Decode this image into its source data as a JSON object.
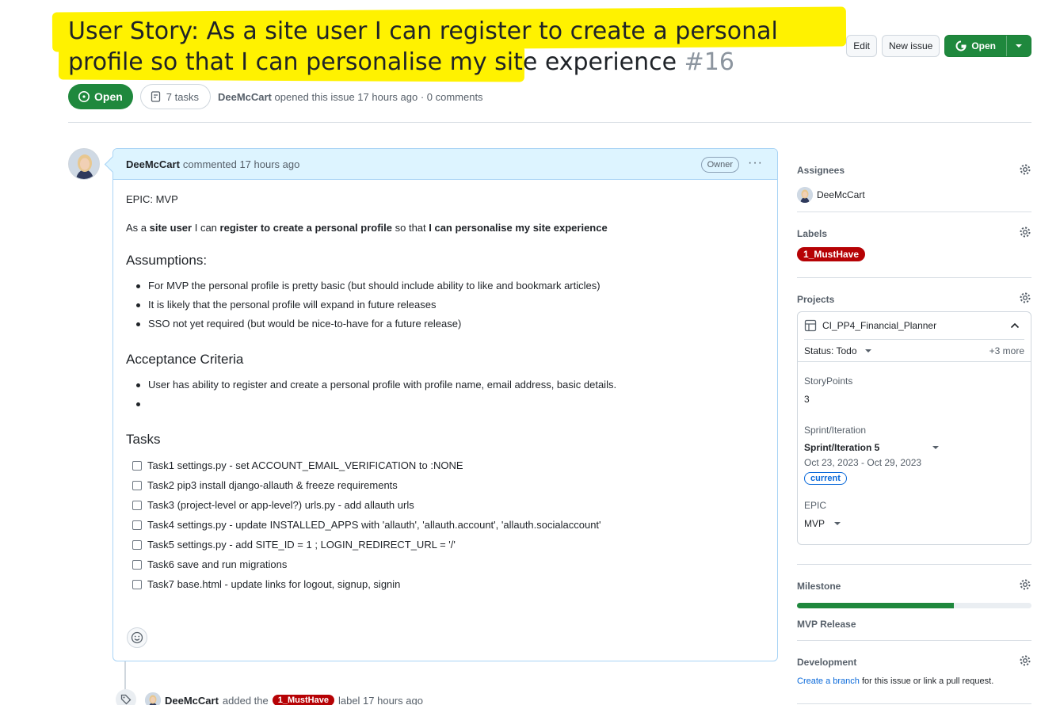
{
  "header": {
    "title": "User Story: As a site user I can register to create a personal profile so that I can personalise my site experience",
    "issue_number": "#16",
    "edit_label": "Edit",
    "new_issue_label": "New issue",
    "open_button_label": "Open",
    "highlight_color": "#fff200"
  },
  "meta": {
    "state": "Open",
    "tasks": "7 tasks",
    "author": "DeeMcCart",
    "opened_text": "opened this issue 17 hours ago · 0 comments"
  },
  "comment": {
    "author": "DeeMcCart",
    "time": "commented 17 hours ago",
    "badge": "Owner",
    "epic_line": "EPIC: MVP",
    "story": {
      "p1": "As a ",
      "b1": "site user",
      "p2": " I can ",
      "b2": "register to create a personal profile",
      "p3": " so that ",
      "b3": "I can personalise my site experience"
    },
    "assumptions_heading": "Assumptions:",
    "assumptions": [
      "For MVP the personal profile is pretty basic (but should include ability to like and bookmark articles)",
      "It is likely that the personal profile will expand in future releases",
      "SSO not yet required (but would be nice-to-have for a future release)"
    ],
    "acceptance_heading": "Acceptance Criteria",
    "acceptance": [
      "User has ability to register and create a personal profile with profile name, email address, basic details.",
      ""
    ],
    "tasks_heading": "Tasks",
    "tasks": [
      "Task1 settings.py - set ACCOUNT_EMAIL_VERIFICATION to :NONE",
      "Task2 pip3 install django-allauth & freeze requirements",
      "Task3 (project-level or app-level?) urls.py - add allauth urls",
      "Task4 settings.py - update INSTALLED_APPS with 'allauth', 'allauth.account', 'allauth.socialaccount'",
      "Task5 settings.py - add SITE_ID = 1 ; LOGIN_REDIRECT_URL = '/'",
      "Task6 save and run migrations",
      "Task7 base.html - update links for logout, signup, signin"
    ]
  },
  "timeline": {
    "actor": "DeeMcCart",
    "action": "added the",
    "label": "1_MustHave",
    "suffix": "label 17 hours ago"
  },
  "sidebar": {
    "assignees_title": "Assignees",
    "assignee": "DeeMcCart",
    "labels_title": "Labels",
    "label": "1_MustHave",
    "label_color": "#b60205",
    "projects_title": "Projects",
    "project_name": "CI_PP4_Financial_Planner",
    "status": "Status: Todo",
    "more": "+3 more",
    "storypoints_label": "StoryPoints",
    "storypoints_value": "3",
    "sprint_label": "Sprint/Iteration",
    "sprint_value": "Sprint/Iteration 5",
    "sprint_dates": "Oct 23, 2023 - Oct 29, 2023",
    "sprint_badge": "current",
    "epic_label": "EPIC",
    "epic_value": "MVP",
    "milestone_title": "Milestone",
    "milestone_progress": 0.67,
    "milestone_name": "MVP Release",
    "development_title": "Development",
    "dev_link": "Create a branch",
    "dev_text": "for this issue or link a pull request."
  }
}
